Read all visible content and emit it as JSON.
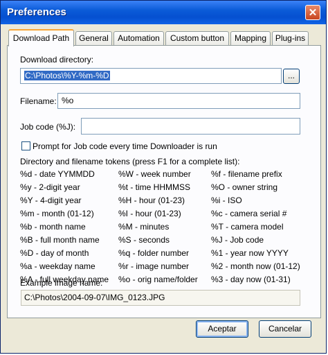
{
  "window": {
    "title": "Preferences",
    "close_glyph": "✕"
  },
  "tabs": [
    {
      "label": "Download Path"
    },
    {
      "label": "General"
    },
    {
      "label": "Automation"
    },
    {
      "label": "Custom button"
    },
    {
      "label": "Mapping"
    },
    {
      "label": "Plug-ins"
    }
  ],
  "download": {
    "directory_label": "Download directory:",
    "directory_value": "C:\\Photos\\%Y-%m-%D",
    "browse_label": "...",
    "filename_label": "Filename:",
    "filename_value": "%o",
    "jobcode_label": "Job code (%J):",
    "jobcode_value": "",
    "prompt_label": "Prompt for Job code every time Downloader is run",
    "prompt_checked": false
  },
  "tokens": {
    "heading": "Directory and filename tokens (press F1 for a complete list):",
    "col1": [
      "%d - date YYMMDD",
      "%y - 2-digit year",
      "%Y - 4-digit year",
      "%m - month (01-12)",
      "%b - month name",
      "%B - full month name",
      "%D - day of month",
      "%a - weekday name",
      "%A - full weekday name"
    ],
    "col2": [
      "%W - week number",
      "%t - time HHMMSS",
      "%H - hour (01-23)",
      "%I - hour (01-23)",
      "%M - minutes",
      "%S - seconds",
      "%q - folder number",
      "%r - image number",
      "%o - orig name/folder"
    ],
    "col3": [
      "%f - filename prefix",
      "%O - owner string",
      "%i - ISO",
      "%c - camera serial #",
      "%T - camera model",
      "%J - Job code",
      "%1 - year now YYYY",
      "%2 - month now (01-12)",
      "%3 - day now (01-31)"
    ]
  },
  "example": {
    "label": "Example image name:",
    "value": "C:\\Photos\\2004-09-07\\IMG_0123.JPG"
  },
  "buttons": {
    "ok_label": "Aceptar",
    "cancel_label": "Cancelar"
  }
}
